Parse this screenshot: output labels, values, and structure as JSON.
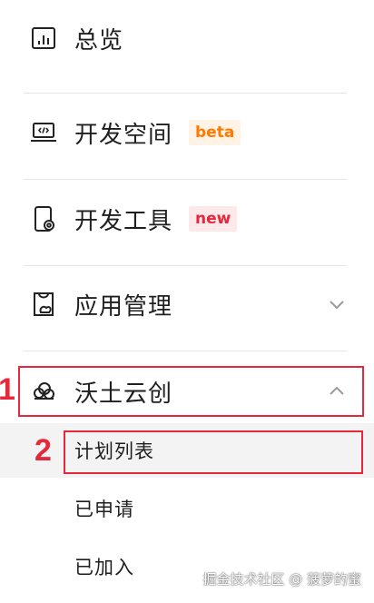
{
  "nav": {
    "overview": {
      "label": "总览",
      "icon": "chart-icon"
    },
    "dev_space": {
      "label": "开发空间",
      "badge": "beta",
      "icon": "laptop-code-icon"
    },
    "dev_tools": {
      "label": "开发工具",
      "badge": "new",
      "icon": "phone-gear-icon"
    },
    "app_manage": {
      "label": "应用管理",
      "icon": "app-manage-icon"
    },
    "wotu_cloud": {
      "label": "沃土云创",
      "icon": "cloud-icon",
      "expanded": true,
      "children": [
        {
          "label": "计划列表",
          "active": true
        },
        {
          "label": "已申请"
        },
        {
          "label": "已加入"
        }
      ]
    }
  },
  "annotations": {
    "marker1": "1",
    "marker2": "2"
  },
  "watermark": "掘金技术社区 @ 菠萝的蜜",
  "colors": {
    "highlight": "#e5283b",
    "beta": "#ff7a00",
    "new": "#e5283b"
  }
}
